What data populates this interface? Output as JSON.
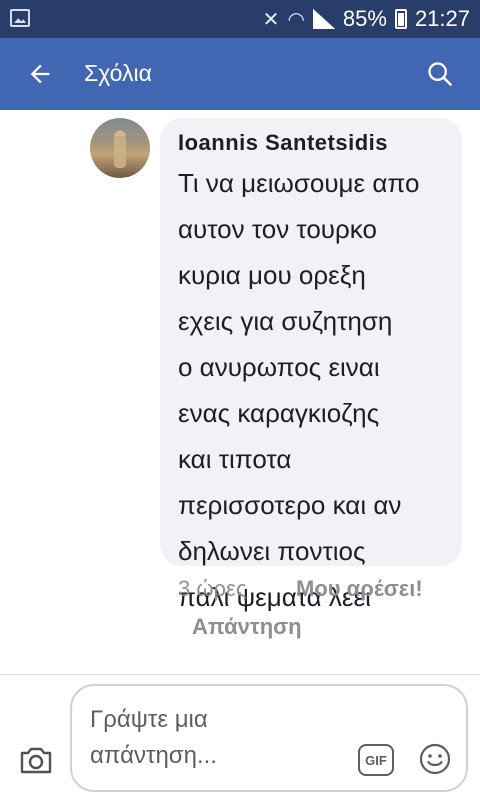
{
  "status_bar": {
    "battery": "85%",
    "time": "21:27"
  },
  "header": {
    "title": "Σχόλια",
    "back_icon": "back-arrow-icon",
    "search_icon": "search-icon"
  },
  "comment": {
    "author": "Ioannis Santetsidis",
    "lines": [
      "Τι να μειωσουμε απο",
      "αυτον τον τουρκο",
      "κυρια μου ορεξη",
      "εχεις για συζητηση",
      "ο ανυρωπος ειναι",
      "ενας καραγκιοζης",
      "και τιποτα",
      "περισσοτερο  και  αν",
      "δηλωνει ποντιος",
      "παλι ψεματα λεει"
    ],
    "time": "3 ώρες",
    "like_label": "Μου αρέσει!",
    "reply_label": "Απάντηση"
  },
  "composer": {
    "placeholder": "Γράψτε μια απάντηση...",
    "gif_label": "GIF",
    "camera_icon": "camera-icon",
    "emoji_icon": "emoji-icon"
  },
  "colors": {
    "status_bar": "#283d6a",
    "app_bar": "#4267b2",
    "bubble": "#f1f2f6",
    "meta_text": "#8c8f96"
  }
}
